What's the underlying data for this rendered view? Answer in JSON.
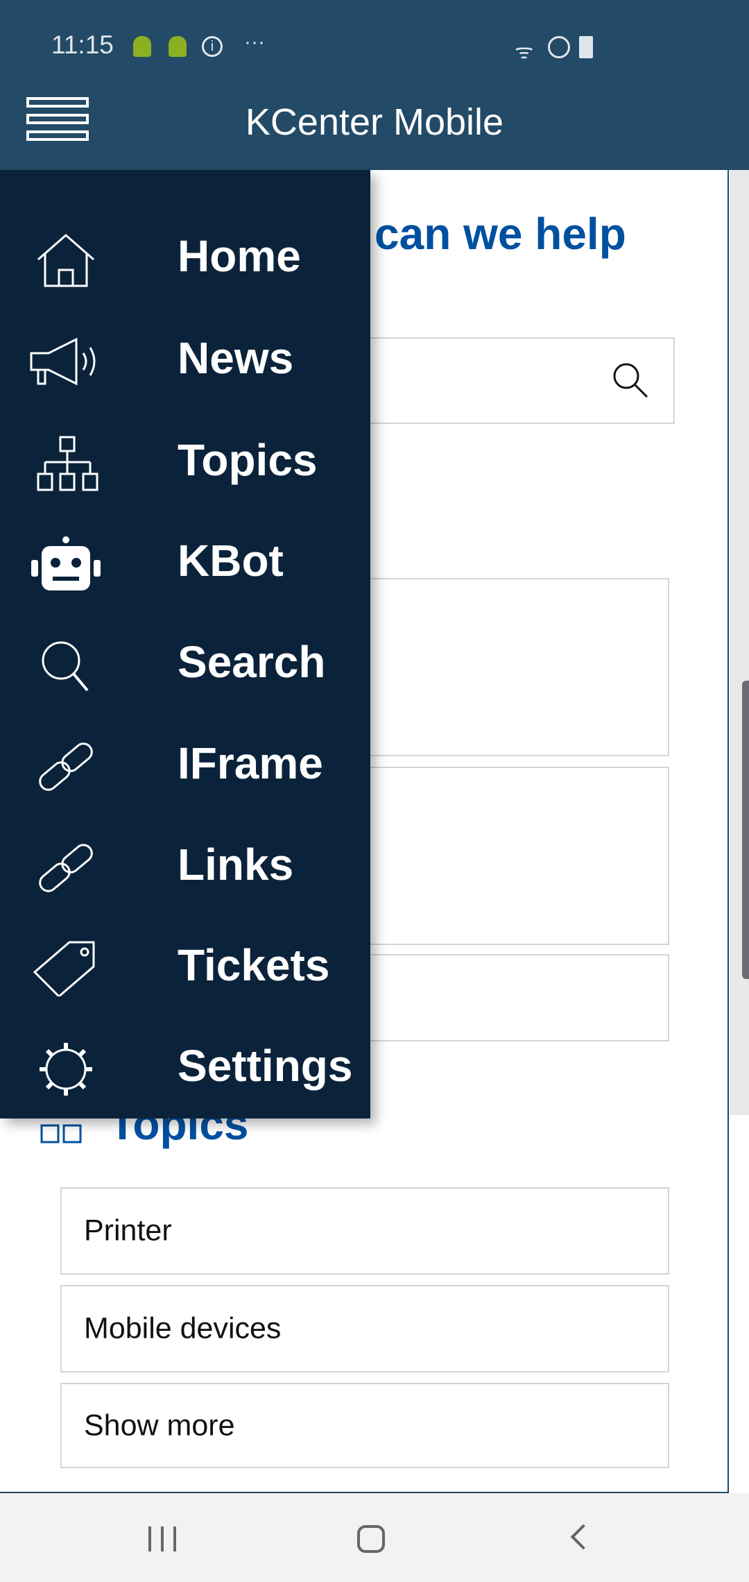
{
  "status_bar": {
    "time": "11:15",
    "icons": [
      "android-icon",
      "android-icon",
      "info-icon",
      "more-dots-icon",
      "wifi-icon",
      "do-not-disturb-icon",
      "battery-charging-icon"
    ]
  },
  "app_bar": {
    "title": "KCenter Mobile",
    "menu_icon": "hamburger-icon"
  },
  "content": {
    "heading": "can we help",
    "search_icon": "search-icon",
    "topics_heading": "Topics",
    "topics": [
      "Printer",
      "Mobile devices",
      "Show more"
    ]
  },
  "drawer": {
    "items": [
      {
        "label": "Home",
        "icon": "home-icon"
      },
      {
        "label": "News",
        "icon": "megaphone-icon"
      },
      {
        "label": "Topics",
        "icon": "sitemap-icon"
      },
      {
        "label": "KBot",
        "icon": "robot-icon"
      },
      {
        "label": "Search",
        "icon": "search-icon"
      },
      {
        "label": "IFrame",
        "icon": "link-icon"
      },
      {
        "label": "Links",
        "icon": "link-icon"
      },
      {
        "label": "Tickets",
        "icon": "tag-icon"
      },
      {
        "label": "Settings",
        "icon": "gear-icon"
      }
    ]
  },
  "colors": {
    "header": "#234a66",
    "drawer": "#0b233a",
    "accent": "#0050a0"
  }
}
